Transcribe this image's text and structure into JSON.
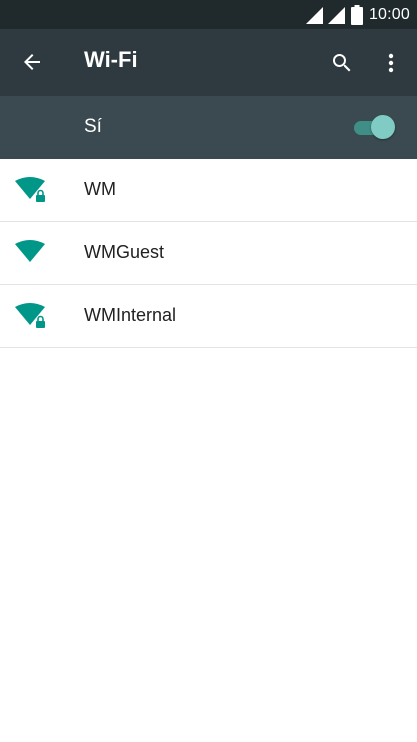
{
  "status_bar": {
    "time": "10:00",
    "icons": [
      "signal-icon",
      "signal-icon",
      "battery-icon"
    ]
  },
  "toolbar": {
    "title": "Wi-Fi",
    "back_icon": "arrow-left-icon",
    "search_icon": "search-icon",
    "more_icon": "more-vert-icon"
  },
  "master_switch": {
    "label": "Sí",
    "on": true
  },
  "networks": [
    {
      "ssid": "WM",
      "secured": true,
      "icon": "wifi-lock-icon"
    },
    {
      "ssid": "WMGuest",
      "secured": false,
      "icon": "wifi-icon"
    },
    {
      "ssid": "WMInternal",
      "secured": true,
      "icon": "wifi-lock-icon"
    }
  ],
  "colors": {
    "status_bar": "#20292c",
    "toolbar": "#2e3a3f",
    "switch_bar": "#3a4a50",
    "accent": "#009688",
    "toggle_thumb": "#80cbc4"
  }
}
